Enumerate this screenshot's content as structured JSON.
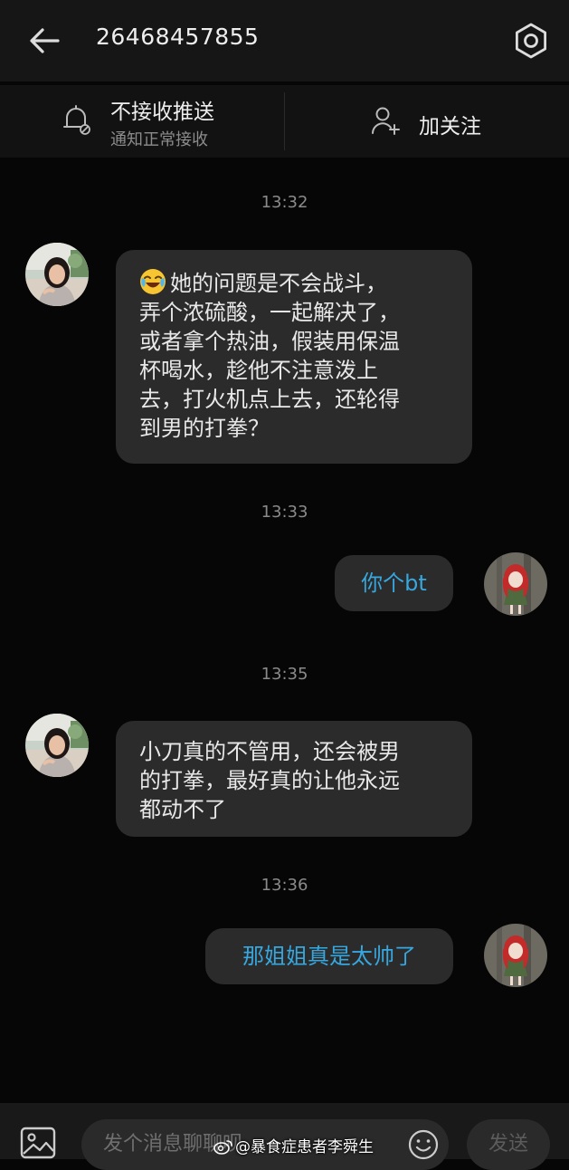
{
  "header": {
    "title": "26468457855",
    "back_icon": "arrow-left-icon",
    "settings_icon": "gear-icon"
  },
  "notice_bar": {
    "push_title": "不接收推送",
    "push_caption": "通知正常接收",
    "push_icon": "bell-off-icon",
    "follow_label": "加关注",
    "follow_icon": "user-add-icon"
  },
  "messages": [
    {
      "type": "timestamp",
      "text": "13:32"
    },
    {
      "type": "incoming",
      "emoji": "crying-laughing-emoji",
      "lines": [
        "她的问题是不会战斗，",
        "弄个浓硫酸，一起解决了，",
        "或者拿个热油，假装用保温",
        "杯喝水，趁他不注意泼上",
        "去，打火机点上去，还轮得",
        "到男的打拳？"
      ]
    },
    {
      "type": "timestamp",
      "text": "13:33"
    },
    {
      "type": "outgoing",
      "text": "你个bt"
    },
    {
      "type": "timestamp",
      "text": "13:35"
    },
    {
      "type": "incoming",
      "lines": [
        "小刀真的不管用，还会被男",
        "的打拳，最好真的让他永远",
        "都动不了"
      ]
    },
    {
      "type": "timestamp",
      "text": "13:36"
    },
    {
      "type": "outgoing",
      "text": "那姐姐真是太帅了"
    }
  ],
  "composer": {
    "placeholder": "发个消息聊聊呗",
    "send_label": "发送",
    "image_icon": "image-icon",
    "emoji_icon": "smiley-icon"
  },
  "watermark": {
    "text": "@暴食症患者李舜生",
    "logo": "weibo-logo"
  },
  "colors": {
    "background": "#060606",
    "header": "#161616",
    "bubble": "#2b2b2b",
    "outgoing_text": "#37a7df",
    "timestamp": "#8a8a8a"
  }
}
